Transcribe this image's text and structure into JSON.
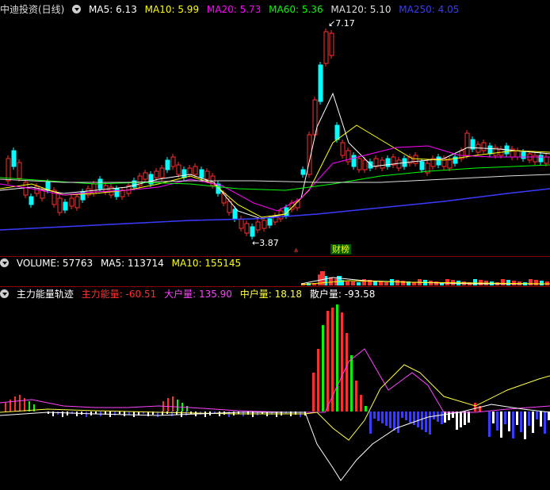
{
  "price_panel": {
    "title": "中迪投资(日线)",
    "ma": [
      {
        "label": "MA5:",
        "value": "6.13",
        "color": "#ffffff"
      },
      {
        "label": "MA10:",
        "value": "5.99",
        "color": "#ffff00"
      },
      {
        "label": "MA20:",
        "value": "5.73",
        "color": "#ff00ff"
      },
      {
        "label": "MA60:",
        "value": "5.36",
        "color": "#00ff00"
      },
      {
        "label": "MA120:",
        "value": "5.10",
        "color": "#dddddd"
      },
      {
        "label": "MA250:",
        "value": "4.05",
        "color": "#3b3bff"
      }
    ],
    "high_label": "7.17",
    "low_label": "3.87",
    "event_tag": "财榜"
  },
  "volume_panel": {
    "label": "VOLUME: 57763",
    "ma5": "MA5: 113714",
    "ma10": "MA10: 155145"
  },
  "energy_panel": {
    "title": "主力能量轨迹",
    "items": [
      {
        "label": "主力能量:",
        "value": "-60.51",
        "color": "#ff3030"
      },
      {
        "label": "大户量:",
        "value": "135.90",
        "color": "#ff44ff"
      },
      {
        "label": "中户量:",
        "value": "18.18",
        "color": "#ffff44"
      },
      {
        "label": "散户量:",
        "value": "-93.58",
        "color": "#ffffff"
      }
    ]
  },
  "colors": {
    "up": "#ff3030",
    "down": "#00ffff",
    "bg": "#000000",
    "separator": "#8b0000"
  }
}
